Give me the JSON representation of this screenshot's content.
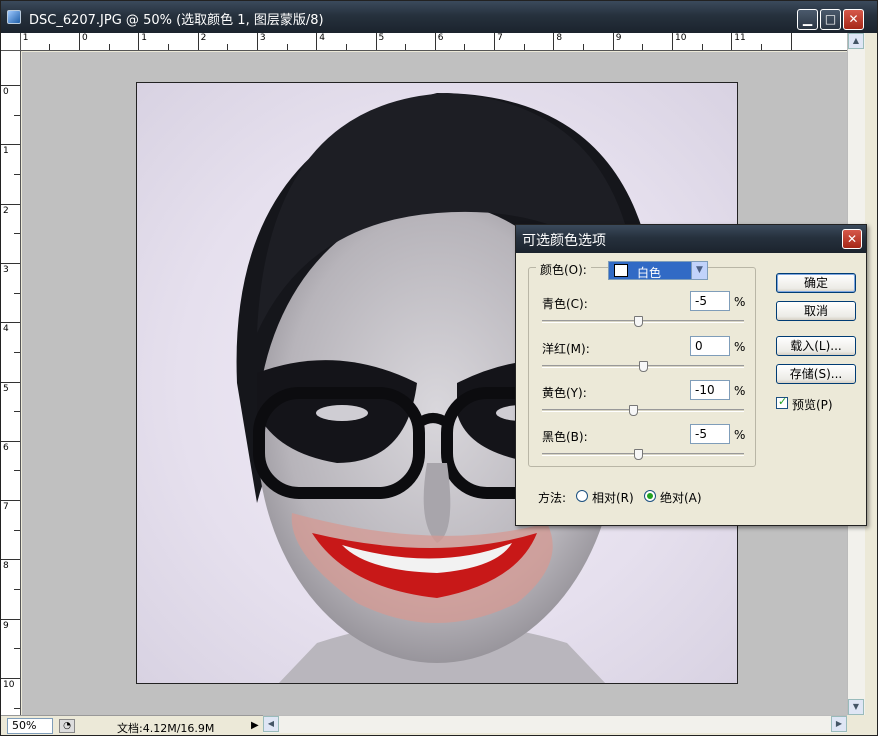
{
  "document": {
    "title": "DSC_6207.JPG @ 50% (选取颜色 1, 图层蒙版/8)",
    "min_label": "▁",
    "max_label": "□",
    "close_label": "✕"
  },
  "ruler": {
    "top_labels": [
      "1",
      "0",
      "1",
      "2",
      "3",
      "4",
      "5",
      "6",
      "7",
      "8",
      "9",
      "10",
      "11"
    ],
    "left_labels": [
      "0",
      "1",
      "2",
      "3",
      "4",
      "5",
      "6",
      "7",
      "8",
      "9",
      "10"
    ]
  },
  "status": {
    "zoom": "50%",
    "doc_info": "文档:4.12M/16.9M",
    "menu_arrow": "▶"
  },
  "dialog": {
    "title": "可选颜色选项",
    "close_label": "✕",
    "color_label": "颜色(O):",
    "color_value": "白色",
    "rows": [
      {
        "label": "青色(C):",
        "value": "-5",
        "unit": "%"
      },
      {
        "label": "洋红(M):",
        "value": "0",
        "unit": "%"
      },
      {
        "label": "黄色(Y):",
        "value": "-10",
        "unit": "%"
      },
      {
        "label": "黑色(B):",
        "value": "-5",
        "unit": "%"
      }
    ],
    "method_label": "方法:",
    "method_relative": "相对(R)",
    "method_absolute": "绝对(A)",
    "method_selected": "absolute",
    "buttons": {
      "ok": "确定",
      "cancel": "取消",
      "load": "载入(L)...",
      "save": "存储(S)..."
    },
    "preview_label": "预览(P)",
    "preview_checked": true
  }
}
